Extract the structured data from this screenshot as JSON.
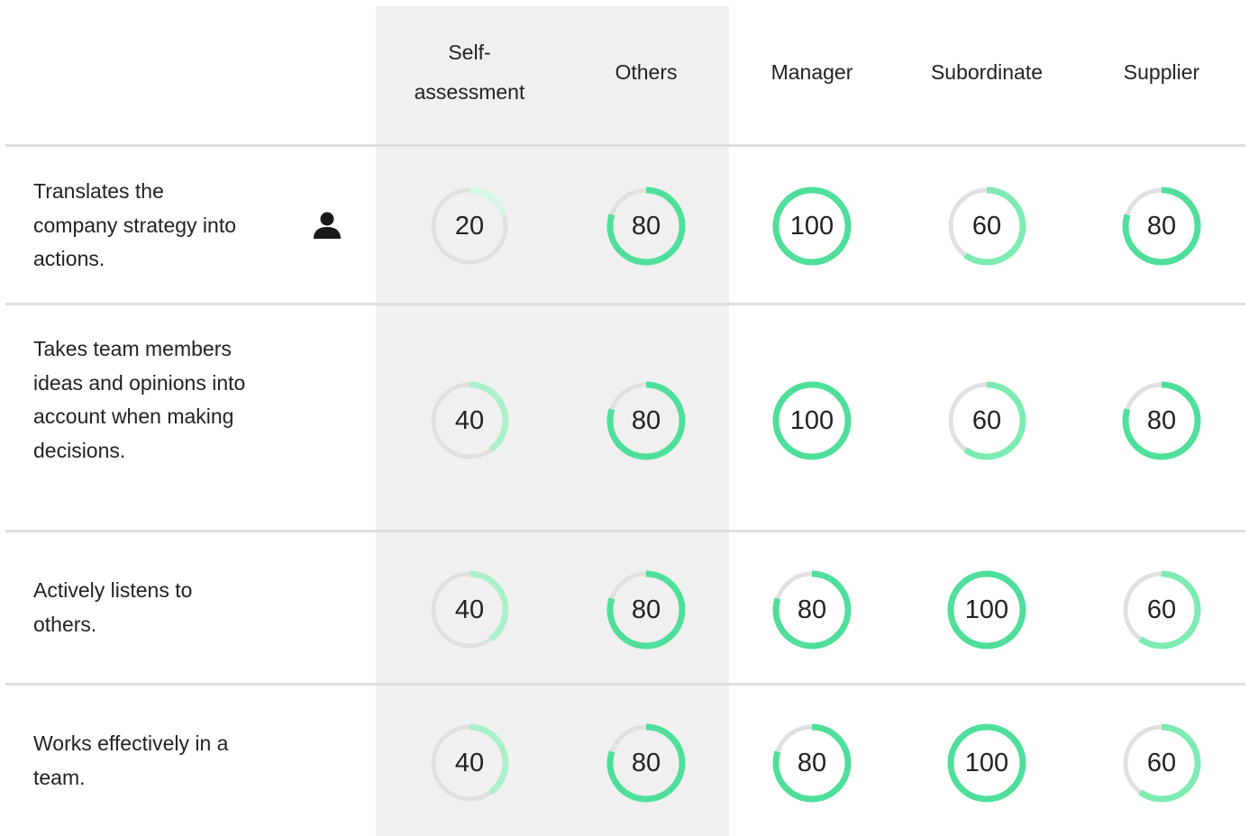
{
  "colors": {
    "track": "#e0e0e0",
    "level_20": "#d4f7e4",
    "level_40": "#abf0cb",
    "level_60": "#7eebb2",
    "level_80": "#4fdf9b",
    "level_100": "#4fdf9b",
    "highlight_column_bg": "#f0f0f0",
    "divider": "#dedede"
  },
  "columns": [
    {
      "key": "self",
      "label": "Self-\nassessment"
    },
    {
      "key": "others",
      "label": "Others"
    },
    {
      "key": "manager",
      "label": "Manager"
    },
    {
      "key": "subordinate",
      "label": "Subordinate"
    },
    {
      "key": "supplier",
      "label": "Supplier"
    }
  ],
  "rows": [
    {
      "statement": "Translates the company strategy into actions.",
      "icon": "person-icon",
      "scores": {
        "self": 20,
        "others": 80,
        "manager": 100,
        "subordinate": 60,
        "supplier": 80
      }
    },
    {
      "statement": "Takes team members ideas and opinions into account when making decisions.",
      "scores": {
        "self": 40,
        "others": 80,
        "manager": 100,
        "subordinate": 60,
        "supplier": 80
      }
    },
    {
      "statement": "Actively listens to others.",
      "scores": {
        "self": 40,
        "others": 80,
        "manager": 80,
        "subordinate": 100,
        "supplier": 60
      }
    },
    {
      "statement": "Works effectively in a team.",
      "scores": {
        "self": 40,
        "others": 80,
        "manager": 80,
        "subordinate": 100,
        "supplier": 60
      }
    }
  ]
}
